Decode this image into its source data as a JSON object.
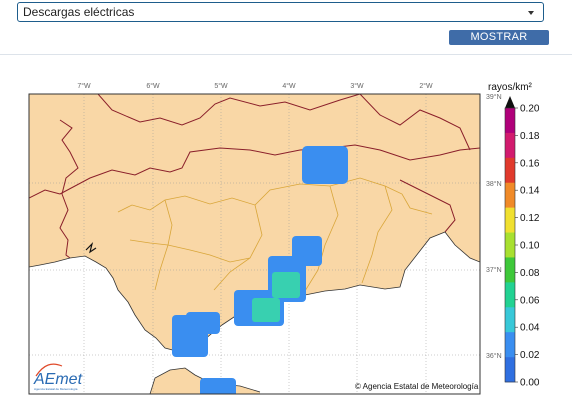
{
  "controls": {
    "product_select": "Descargas eléctricas",
    "show_button": "MOSTRAR"
  },
  "map": {
    "lon_labels": [
      "7°W",
      "6°W",
      "5°W",
      "4°W",
      "3°W",
      "2°W"
    ],
    "lat_labels": [
      "39°N",
      "38°N",
      "37°N",
      "36°N"
    ],
    "credit": "© Agencia Estatal de Meteorología",
    "logo_text": "AEmet",
    "logo_subtitle": "Agencia Estatal de Meteorología"
  },
  "colorbar": {
    "title": "rayos/km²",
    "ticks": [
      "0.20",
      "0.18",
      "0.16",
      "0.14",
      "0.12",
      "0.10",
      "0.08",
      "0.06",
      "0.04",
      "0.02",
      "0.00"
    ],
    "colors": [
      "#b0007a",
      "#d21b6e",
      "#e03a2c",
      "#f08a28",
      "#f0e030",
      "#a8e030",
      "#3ec83a",
      "#22d292",
      "#38c8d8",
      "#3a8ef0",
      "#2f6fe0"
    ]
  },
  "colors": {
    "land": "#f9d7a6",
    "sea": "#ffffff",
    "border": "#8a1f2a",
    "province": "#d9a63a",
    "strike_low": "#3a8ef0",
    "strike_mid": "#38d0b0"
  }
}
